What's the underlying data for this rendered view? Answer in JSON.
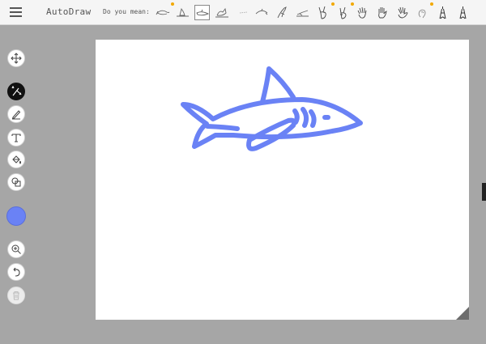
{
  "app": {
    "title": "AutoDraw"
  },
  "suggestions": {
    "label": "Do you mean:",
    "items": [
      {
        "name": "fish",
        "icon": "fish-icon"
      },
      {
        "name": "shark-fin",
        "icon": "shark-fin-icon"
      },
      {
        "name": "shark",
        "icon": "shark-icon",
        "selected": true
      },
      {
        "name": "whale",
        "icon": "whale-icon"
      },
      {
        "name": "line",
        "icon": "line-icon"
      },
      {
        "name": "dolphin",
        "icon": "dolphin-icon"
      },
      {
        "name": "bird",
        "icon": "bird-icon"
      },
      {
        "name": "swoosh",
        "icon": "swoosh-icon"
      },
      {
        "name": "peace-hand",
        "icon": "peace-hand-icon"
      },
      {
        "name": "victory-hand",
        "icon": "victory-hand-icon"
      },
      {
        "name": "open-hand",
        "icon": "open-hand-icon"
      },
      {
        "name": "raised-hand",
        "icon": "raised-hand-icon"
      },
      {
        "name": "wave-hand",
        "icon": "wave-hand-icon"
      },
      {
        "name": "fist",
        "icon": "fist-icon"
      },
      {
        "name": "eiffel-tower",
        "icon": "eiffel-tower-icon"
      },
      {
        "name": "eiffel-tower-2",
        "icon": "eiffel-tower-icon"
      }
    ]
  },
  "toolbar": {
    "tools": [
      {
        "name": "move-tool",
        "icon": "move-arrows-icon"
      },
      {
        "name": "autodraw-tool",
        "icon": "autodraw-magic-icon",
        "active": true
      },
      {
        "name": "draw-tool",
        "icon": "pencil-icon"
      },
      {
        "name": "type-tool",
        "icon": "text-icon"
      },
      {
        "name": "fill-tool",
        "icon": "paint-bucket-icon"
      },
      {
        "name": "shape-tool",
        "icon": "shapes-icon"
      },
      {
        "name": "zoom-tool",
        "icon": "zoom-in-icon"
      },
      {
        "name": "undo-tool",
        "icon": "undo-icon"
      },
      {
        "name": "delete-tool",
        "icon": "trash-icon",
        "disabled": true
      }
    ],
    "current_color": "#6a82f5"
  },
  "canvas": {
    "drawing": "shark",
    "stroke_color": "#6a82f5"
  }
}
